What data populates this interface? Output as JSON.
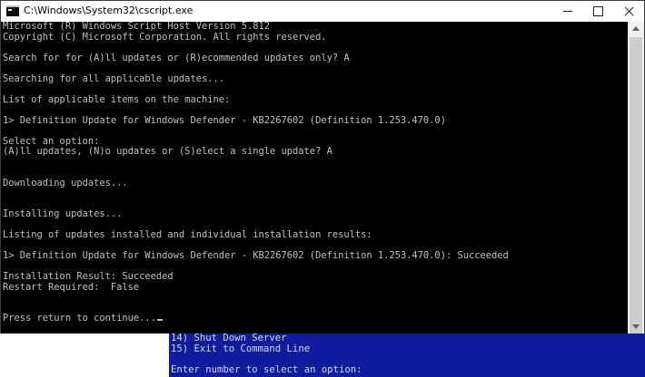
{
  "window": {
    "title": "C:\\Windows\\System32\\cscript.exe"
  },
  "console_lines": [
    "Microsoft (R) Windows Script Host Version 5.812",
    "Copyright (C) Microsoft Corporation. All rights reserved.",
    "",
    "Search for for (A)ll updates or (R)ecommended updates only? A",
    "",
    "Searching for all applicable updates...",
    "",
    "List of applicable items on the machine:",
    "",
    "1> Definition Update for Windows Defender - KB2267602 (Definition 1.253.470.0)",
    "",
    "Select an option:",
    "(A)ll updates, (N)o updates or (S)elect a single update? A",
    "",
    "",
    "Downloading updates...",
    "",
    "",
    "Installing updates...",
    "",
    "Listing of updates installed and individual installation results:",
    "",
    "1> Definition Update for Windows Defender - KB2267602 (Definition 1.253.470.0): Succeeded",
    "",
    "Installation Result: Succeeded",
    "Restart Required:  False",
    "",
    "",
    "Press return to continue..."
  ],
  "background_console": {
    "lines": [
      "14) Shut Down Server",
      "15) Exit to Command Line",
      "",
      "Enter number to select an option:"
    ],
    "color": "#0f1ca0"
  },
  "colors": {
    "console_bg": "#000000",
    "console_text": "#c0c0c0"
  }
}
